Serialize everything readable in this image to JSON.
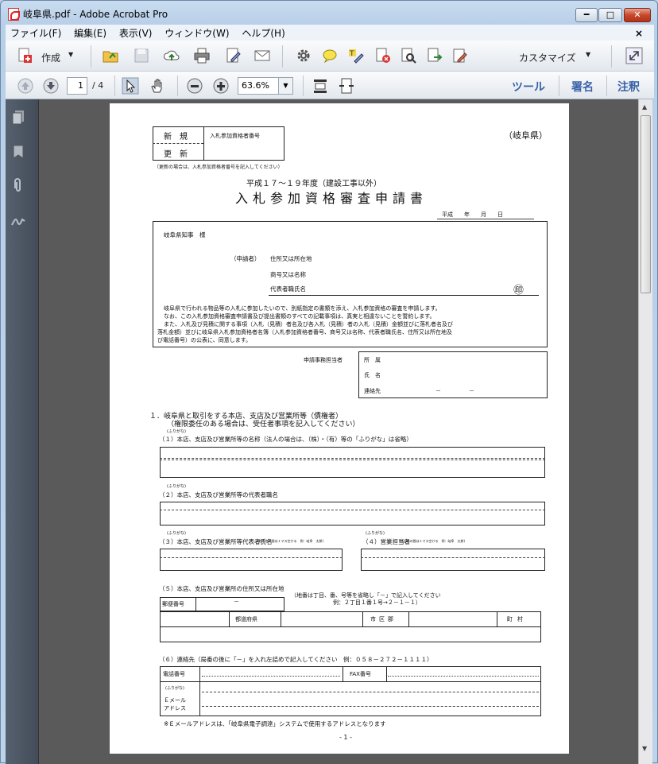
{
  "window": {
    "title": "岐阜県.pdf - Adobe Acrobat Pro",
    "min": "━",
    "max": "□",
    "close": "✕"
  },
  "menu": [
    "ファイル(F)",
    "編集(E)",
    "表示(V)",
    "ウィンドウ(W)",
    "ヘルプ(H)"
  ],
  "menu_close": "×",
  "toolbar": {
    "create": "作成",
    "customize": "カスタマイズ"
  },
  "nav": {
    "page_current": "1",
    "page_total": "/ 4",
    "zoom": "63.6%",
    "tools": "ツール",
    "sign": "署名",
    "comment": "注釈"
  },
  "doc": {
    "box_new": "新　規",
    "box_renew": "更　新",
    "box_number_label": "入札参加資格者番号",
    "prefecture": "（岐阜県）",
    "renew_note": "（更新の場合は、入札参加資格者番号を記入してください）",
    "subtitle": "平成１７～１９年度（建設工事以外）",
    "title": "入札参加資格審査申請書",
    "date": "平成　　年　　月　　日",
    "addressee": "岐阜県知事　様",
    "applicant": "（申請者）",
    "address_label": "住所又は所在地",
    "trade_name": "商号又は名称",
    "rep_name": "代表者職氏名",
    "seal": "㊞",
    "para1": "岐阜県で行われる物品等の入札に参加したいので、別紙指定の書類を添え、入札参加資格の審査を申請します。",
    "para2": "なお、この入札参加資格審査申請書及び提出書類のすべての記載事項は、真実と相違ないことを誓約します。",
    "para3a": "また、入札及び見積に関する事項（入札（見積）者名及び各入札（見積）者の入札（見積）金額並びに落札者名及び",
    "para3b": "落札金額）並びに岐阜県入札参加資格者名簿（入札参加資格者番号、商号又は名称、代表者職氏名、住所又は所在地及",
    "para3c": "び電話番号）の公表に、同意します。",
    "contact_label": "申請事務担当者",
    "contact_place": "所　属",
    "contact_name": "氏　名",
    "contact_tel": "連絡先",
    "contact_dash": "－　　　　　－",
    "s1": "１．岐阜県と取引をする本店、支店及び営業所等（債権者）",
    "s1b": "（権限委任のある場合は、受任者事項を記入してください）",
    "furigana": "(ふりがな)",
    "q1": "（１）本店、支店及び営業所等の名称（法人の場合は、（株）・（有）等の「ふりがな」は省略）",
    "q2": "（２）本店、支店及び営業所等の代表者職名",
    "q3": "（３）本店、支店及び営業所等代表者氏名",
    "q3note": "(姓と名の間は１マス空ける　例：岐阜　太郎)",
    "q4": "（４）営業担当者",
    "q4note": "(姓と名の間は１マス空ける　例：岐阜　太郎)",
    "q5": "（５）本店、支店及び営業所の住所又は所在地",
    "q5note1": "（地番は丁目、番、号等を省略し「－」で記入してください",
    "q5note2": "例：２丁目１番１号→２－１－１）",
    "postal": "郵便番号",
    "postal_dash": "－",
    "pref": "都道府県",
    "city": "市区郡",
    "town": "町村",
    "q6": "（６）連絡先（局番の後に「－」を入れ左詰めで記入してください　例：０５８－２７２－１１１１）",
    "tel": "電話番号",
    "fax": "FAX番号",
    "email_label1": "Ｅメール",
    "email_label2": "アドレス",
    "email_note": "※Ｅメールアドレスは、「岐阜県電子調達」システムで使用するアドレスとなります",
    "page_no": "- 1 -"
  }
}
